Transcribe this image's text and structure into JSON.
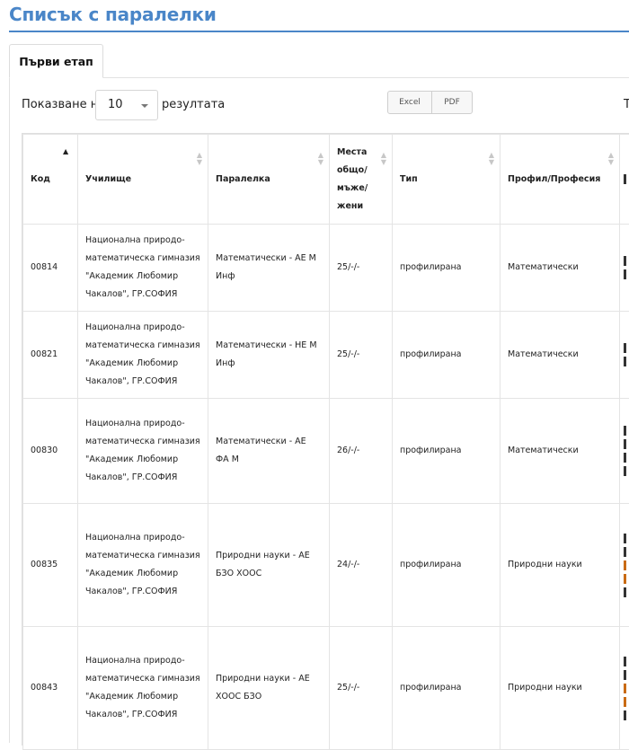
{
  "page_title": "Списък с паралелки",
  "tabs": [
    {
      "label": "Първи етап",
      "active": true
    }
  ],
  "length": {
    "prefix": "Показване на",
    "value": "10",
    "suffix": "резултата"
  },
  "export": {
    "excel": "Excel",
    "pdf": "PDF"
  },
  "cut_label": "Т",
  "table": {
    "headers": {
      "code": "Код",
      "school": "Училище",
      "class": "Паралелка",
      "places": "Места общо/ мъже/ жени",
      "type": "Тип",
      "profile": "Профил/Професия"
    },
    "rows": [
      {
        "code": "00814",
        "school": "Национална природо-математическа гимназия \"Академик Любомир Чакалов\", ГР.СОФИЯ",
        "class": "Математически - АЕ М Инф",
        "places": "25/-/-",
        "type": "профилирана",
        "profile": "Математически"
      },
      {
        "code": "00821",
        "school": "Национална природо-математическа гимназия \"Академик Любомир Чакалов\", ГР.СОФИЯ",
        "class": "Математически - НЕ М Инф",
        "places": "25/-/-",
        "type": "профилирана",
        "profile": "Математически"
      },
      {
        "code": "00830",
        "school": "Национална природо-математическа гимназия \"Академик Любомир Чакалов\", ГР.СОФИЯ",
        "class": "Математически - АЕ ФА М",
        "places": "26/-/-",
        "type": "профилирана",
        "profile": "Математически"
      },
      {
        "code": "00835",
        "school": "Национална природо-математическа гимназия \"Академик Любомир Чакалов\", ГР.СОФИЯ",
        "class": "Природни науки - АЕ БЗО ХООС",
        "places": "24/-/-",
        "type": "профилирана",
        "profile": "Природни науки"
      },
      {
        "code": "00843",
        "school": "Национална природо-математическа гимназия \"Академик Любомир Чакалов\", ГР.СОФИЯ",
        "class": "Природни науки - АЕ ХООС БЗО",
        "places": "25/-/-",
        "type": "профилирана",
        "profile": "Природни науки"
      }
    ]
  },
  "colors": {
    "accent": "#4a86c8",
    "border": "#e4e4e4"
  }
}
